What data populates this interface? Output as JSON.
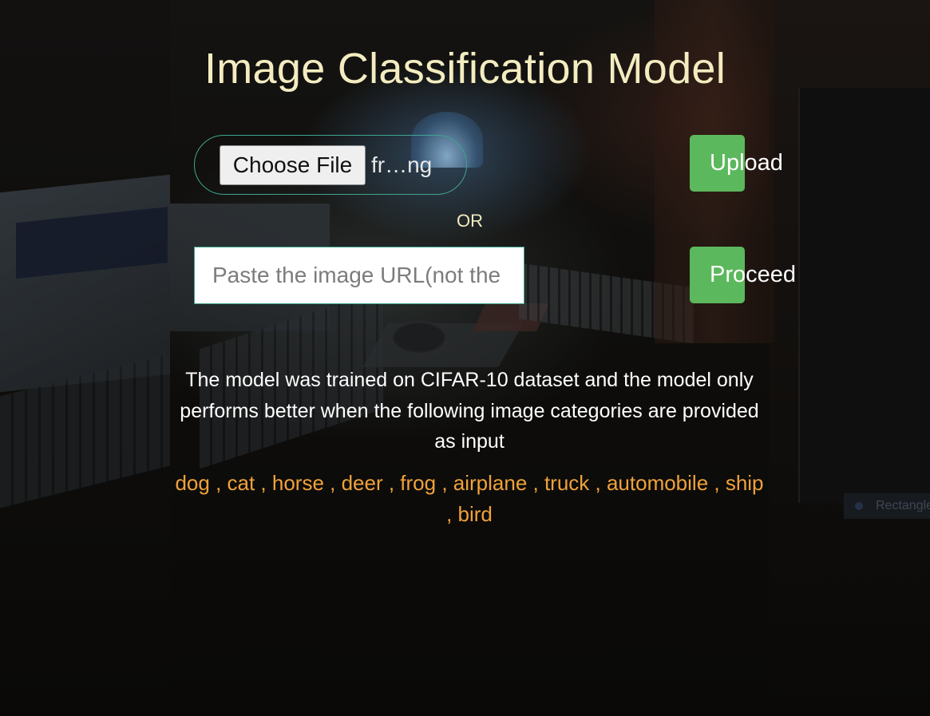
{
  "app": {
    "title": "Image Classification Model"
  },
  "upload": {
    "choose_file_label": "Choose File",
    "file_name": "fr…ng",
    "upload_label": "Upload"
  },
  "divider": {
    "label": "OR"
  },
  "url": {
    "placeholder": "Paste the image URL(not the file name)",
    "value": "",
    "proceed_label": "Proceed"
  },
  "info": {
    "description": "The model was trained on CIFAR-10 dataset and the model only performs better when the following image categories are provided as input",
    "categories_text": "dog , cat , horse , deer , frog , airplane , truck , automobile , ship , bird"
  },
  "background": {
    "chip_label": "Rectangle"
  },
  "colors": {
    "title": "#f3ecc0",
    "accent_green": "#5cb85c",
    "border_teal": "#3fa58f",
    "category_orange": "#f0a23a",
    "background": "#0b0a08"
  }
}
